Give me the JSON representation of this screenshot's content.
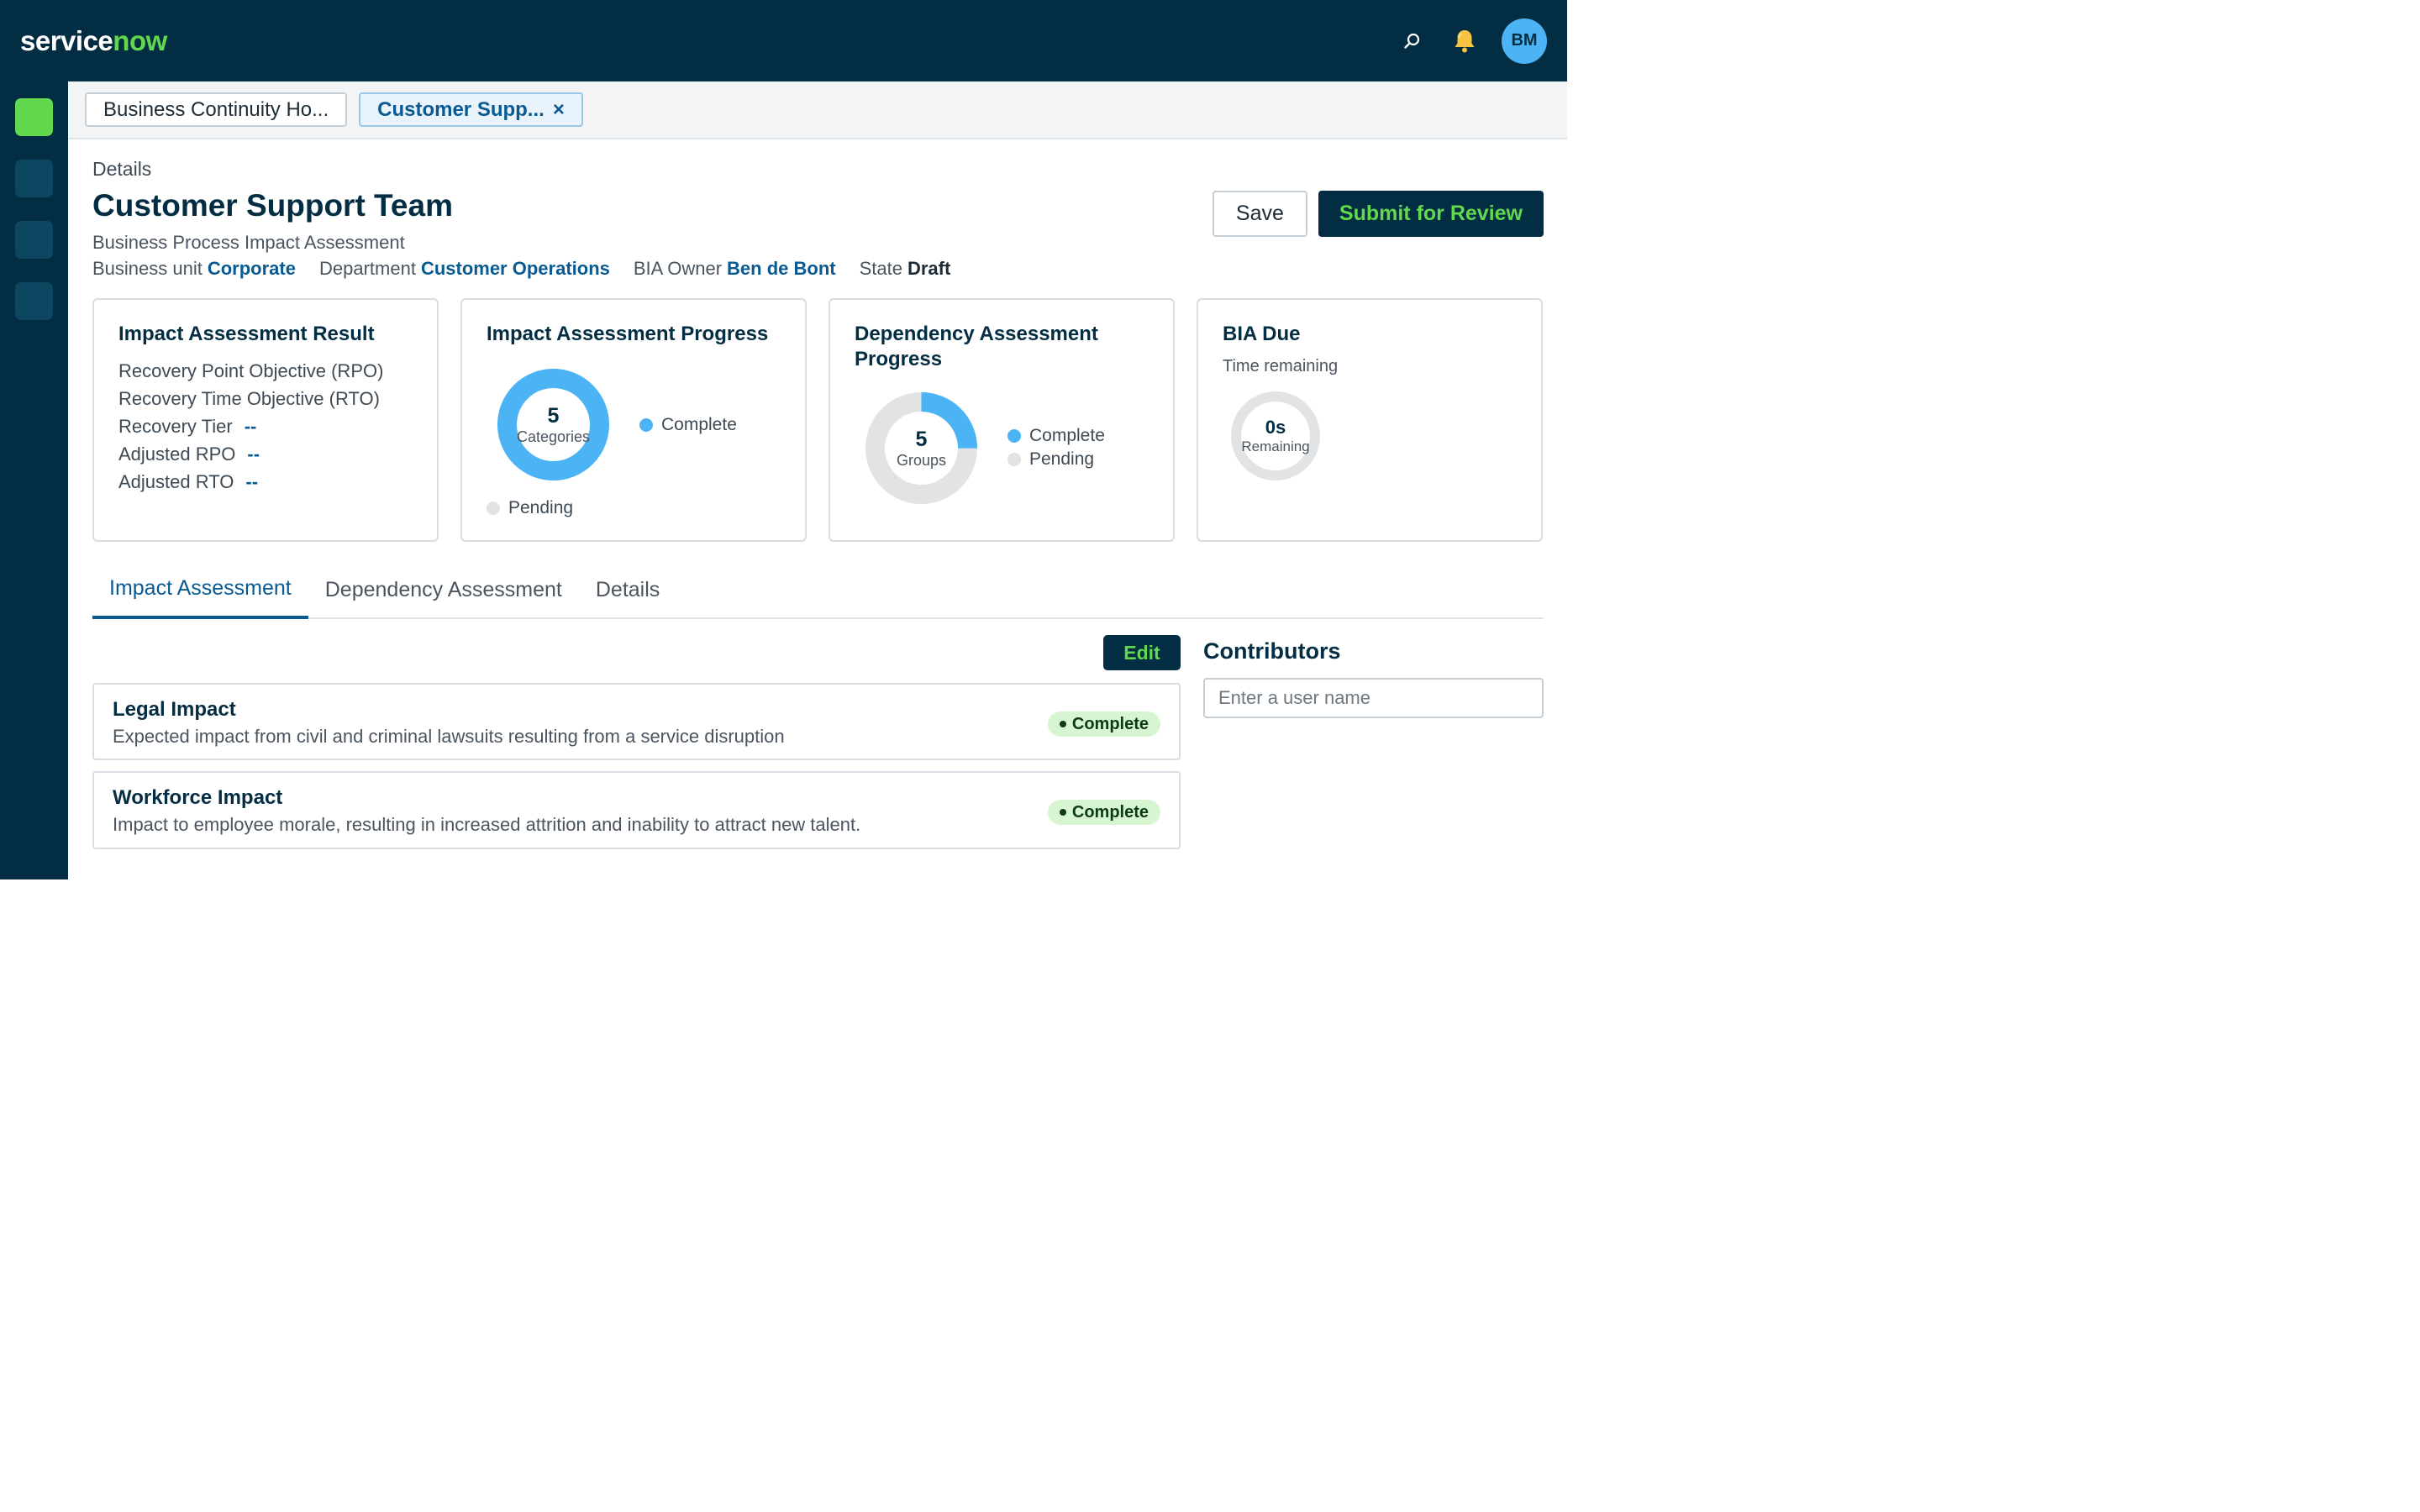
{
  "header": {
    "logo_service": "service",
    "logo_now": "now",
    "icons": [
      "search-icon",
      "bell-icon"
    ],
    "avatar_initials": "BM"
  },
  "window_tabs": [
    {
      "label": "Business Continuity Ho...",
      "active": false
    },
    {
      "label": "Customer Supp...",
      "active": true,
      "close": "×"
    }
  ],
  "record": {
    "breadcrumb": "Details",
    "title": "Customer Support Team",
    "subtitle": "Business Process Impact Assessment",
    "meta": {
      "business_unit_label": "Business unit",
      "business_unit": "Corporate",
      "department_label": "Department",
      "department": "Customer Operations",
      "owner_label": "BIA Owner",
      "owner": "Ben de Bont",
      "state_label": "State",
      "state": "Draft"
    }
  },
  "actions": {
    "save": "Save",
    "submit": "Submit for Review"
  },
  "cards": {
    "result": {
      "title": "Impact Assessment Result",
      "rows": [
        {
          "label": "Recovery Point Objective (RPO)",
          "value": ""
        },
        {
          "label": "Recovery Time Objective (RTO)",
          "value": ""
        },
        {
          "label": "Recovery Tier",
          "value": "--"
        },
        {
          "label": "Adjusted RPO",
          "value": "--"
        },
        {
          "label": "Adjusted RTO",
          "value": "--"
        }
      ]
    },
    "impact_progress": {
      "title": "Impact Assessment Progress",
      "total": "5",
      "caption": "Categories",
      "complete_fraction": 1.0,
      "legend_complete": "Complete",
      "legend_pending": "Pending"
    },
    "dependency_progress": {
      "title": "Dependency Assessment Progress",
      "total": "5",
      "caption": "Groups",
      "complete_fraction": 0.25,
      "legend_complete": "Complete",
      "legend_pending": "Pending"
    },
    "bia_due": {
      "title": "BIA Due",
      "subtitle": "Time remaining",
      "value": "0s",
      "caption": "Remaining"
    }
  },
  "tabs": [
    {
      "label": "Impact Assessment",
      "active": true
    },
    {
      "label": "Dependency Assessment",
      "active": false
    },
    {
      "label": "Details",
      "active": false
    }
  ],
  "impact_list": {
    "edit_label": "Edit",
    "items": [
      {
        "title": "Legal Impact",
        "description": "Expected impact from civil and criminal lawsuits resulting from a service disruption",
        "status": "Complete"
      },
      {
        "title": "Workforce Impact",
        "description": "Impact to employee morale, resulting in increased attrition and inability to attract new talent.",
        "status": "Complete"
      }
    ]
  },
  "contributors": {
    "title": "Contributors",
    "placeholder": "Enter a user name",
    "value": ""
  },
  "colors": {
    "nav": "#032d42",
    "brand_green": "#62d84e",
    "link_blue": "#0a5a92",
    "progress_blue": "#4cb4f5",
    "pending_gray": "#e1e3e5",
    "badge_bg": "#d8f5d2"
  }
}
